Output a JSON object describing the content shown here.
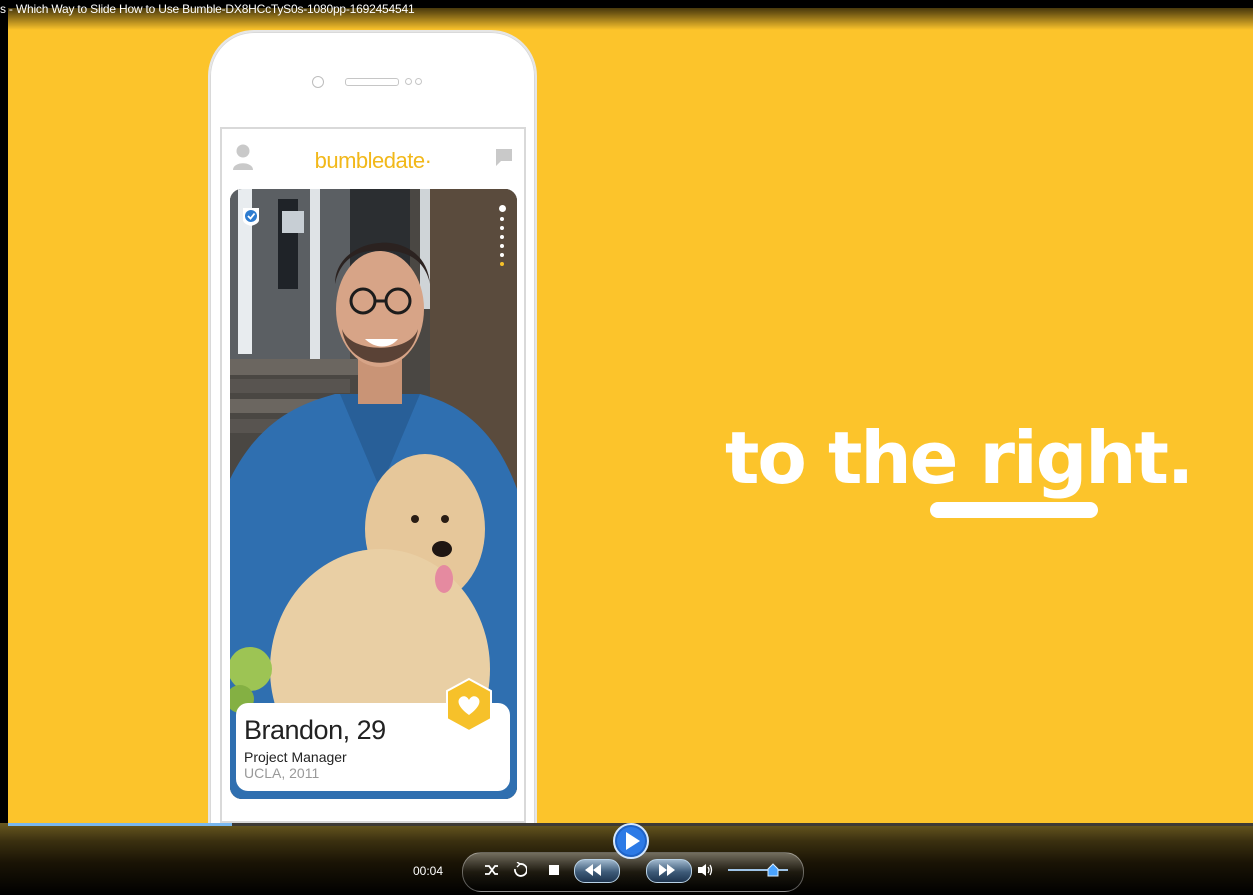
{
  "window": {
    "title": "s - Which Way to Slide How to Use Bumble-DX8HCcTyS0s-1080pp-1692454541"
  },
  "video": {
    "background_color": "#fcc42b",
    "app": {
      "brand": "bumbledate·",
      "profile_icon": "person-icon",
      "chat_icon": "chat-bubble-icon"
    },
    "card": {
      "name": "Brandon, 29",
      "job": "Project Manager",
      "school": "UCLA, 2011",
      "verified_icon": "verified-check-icon",
      "heart_icon": "heart-icon",
      "photo_dots": 7,
      "active_dot": 1
    },
    "slogan": "to the right.",
    "accent_color": "#f6c12a"
  },
  "player": {
    "elapsed": "00:04",
    "progress_fraction": 0.18,
    "volume_fraction": 0.75,
    "buttons": [
      "shuffle-icon",
      "repeat-icon",
      "stop-icon",
      "previous-icon",
      "play-icon",
      "next-icon",
      "volume-icon"
    ]
  }
}
